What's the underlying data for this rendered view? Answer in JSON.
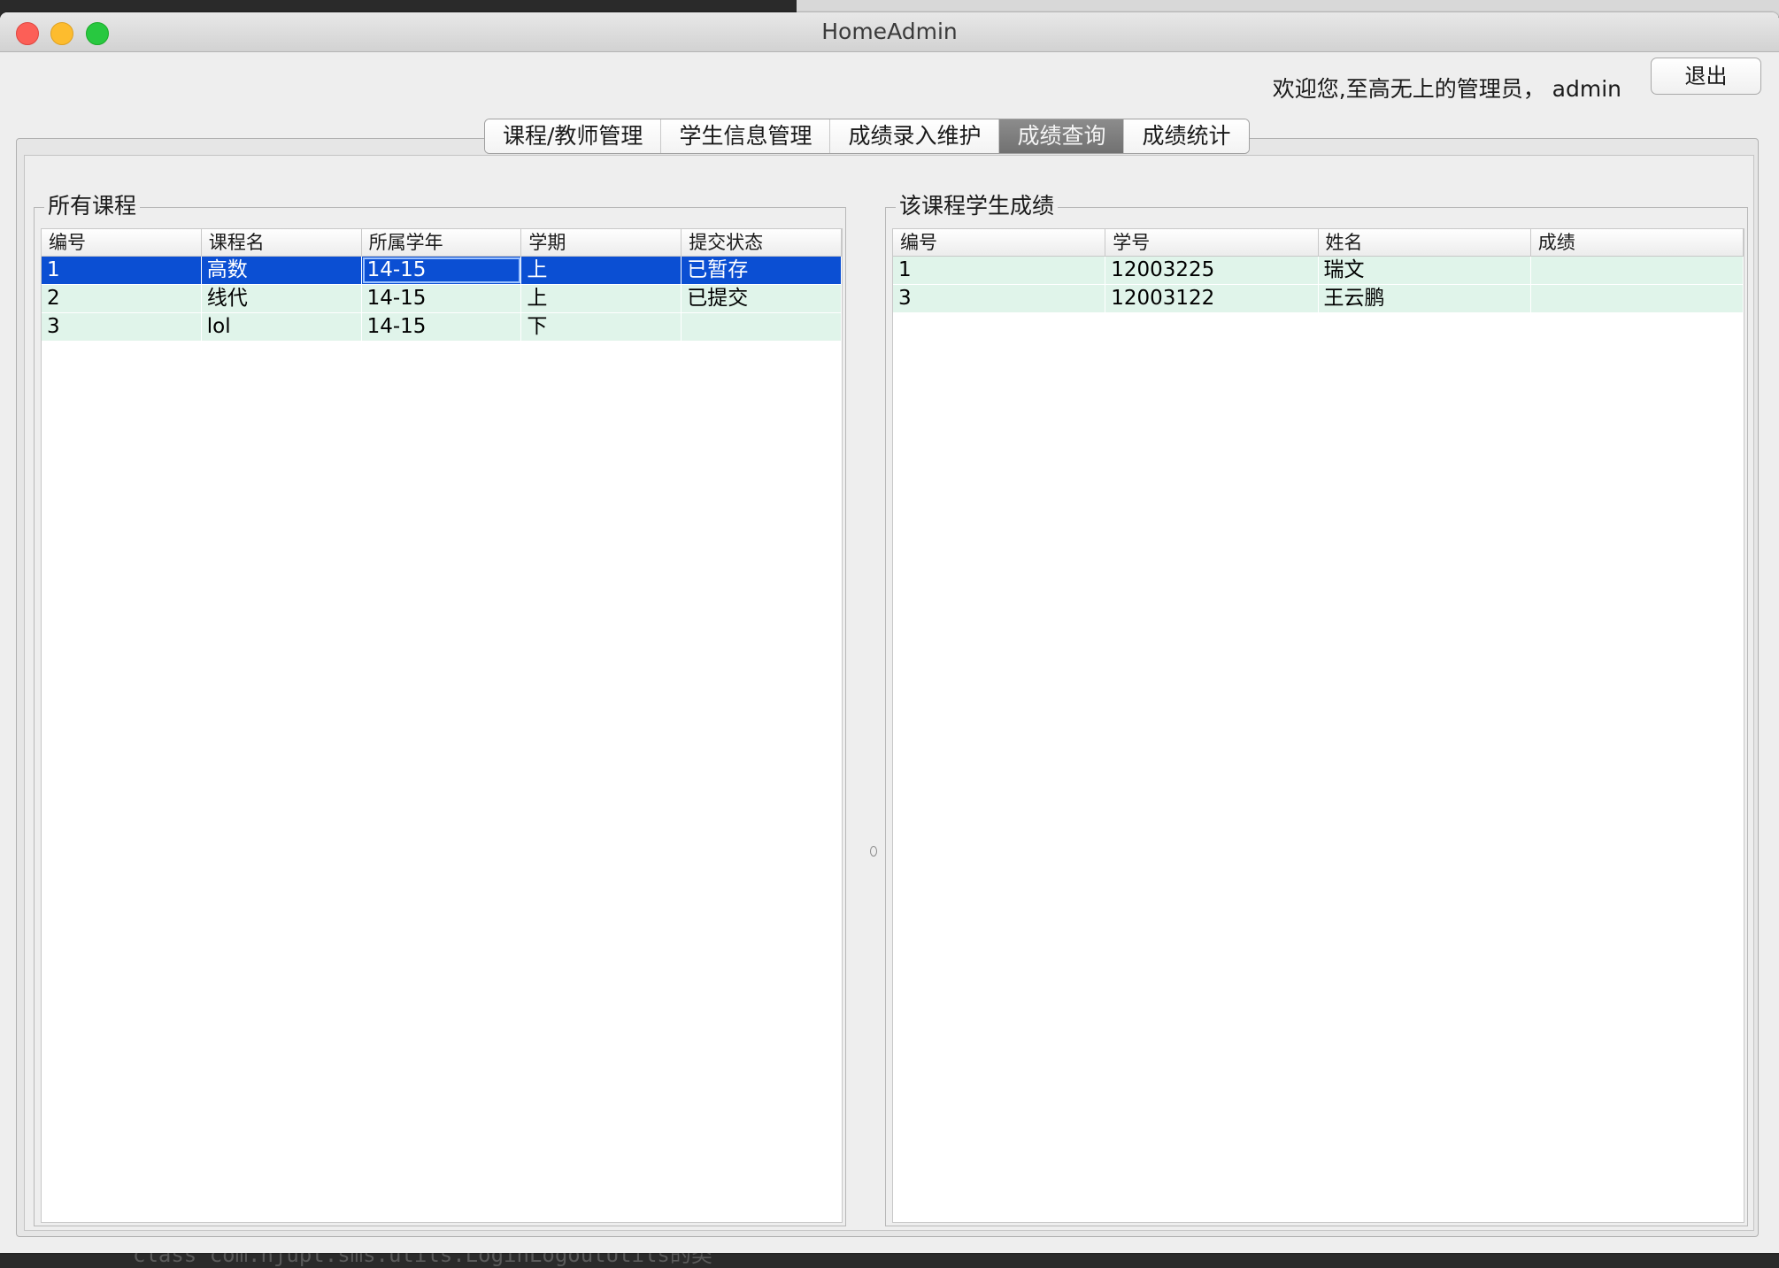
{
  "window": {
    "title": "HomeAdmin"
  },
  "header": {
    "welcome": "欢迎您,至高无上的管理员，  admin",
    "logout_label": "退出"
  },
  "tabs": [
    {
      "label": "课程/教师管理",
      "active": false
    },
    {
      "label": "学生信息管理",
      "active": false
    },
    {
      "label": "成绩录入维护",
      "active": false
    },
    {
      "label": "成绩查询",
      "active": true
    },
    {
      "label": "成绩统计",
      "active": false
    }
  ],
  "courses": {
    "title": "所有课程",
    "columns": [
      "编号",
      "课程名",
      "所属学年",
      "学期",
      "提交状态"
    ],
    "rows": [
      [
        "1",
        "高数",
        "14-15",
        "上",
        "已暂存"
      ],
      [
        "2",
        "线代",
        "14-15",
        "上",
        "已提交"
      ],
      [
        "3",
        "lol",
        "14-15",
        "下",
        ""
      ]
    ],
    "selected_row": 0
  },
  "scores": {
    "title": "该课程学生成绩",
    "columns": [
      "编号",
      "学号",
      "姓名",
      "成绩"
    ],
    "rows": [
      [
        "1",
        "12003225",
        "瑞文",
        ""
      ],
      [
        "3",
        "12003122",
        "王云鹏",
        ""
      ]
    ]
  },
  "background": {
    "code_text": "class com.njupt.sms.utils.LoginLogoutUtils的类"
  },
  "colors": {
    "selection": "#0b4fd3",
    "row_bg": "#e0f4ea",
    "active_tab": "#7d7d7d"
  }
}
